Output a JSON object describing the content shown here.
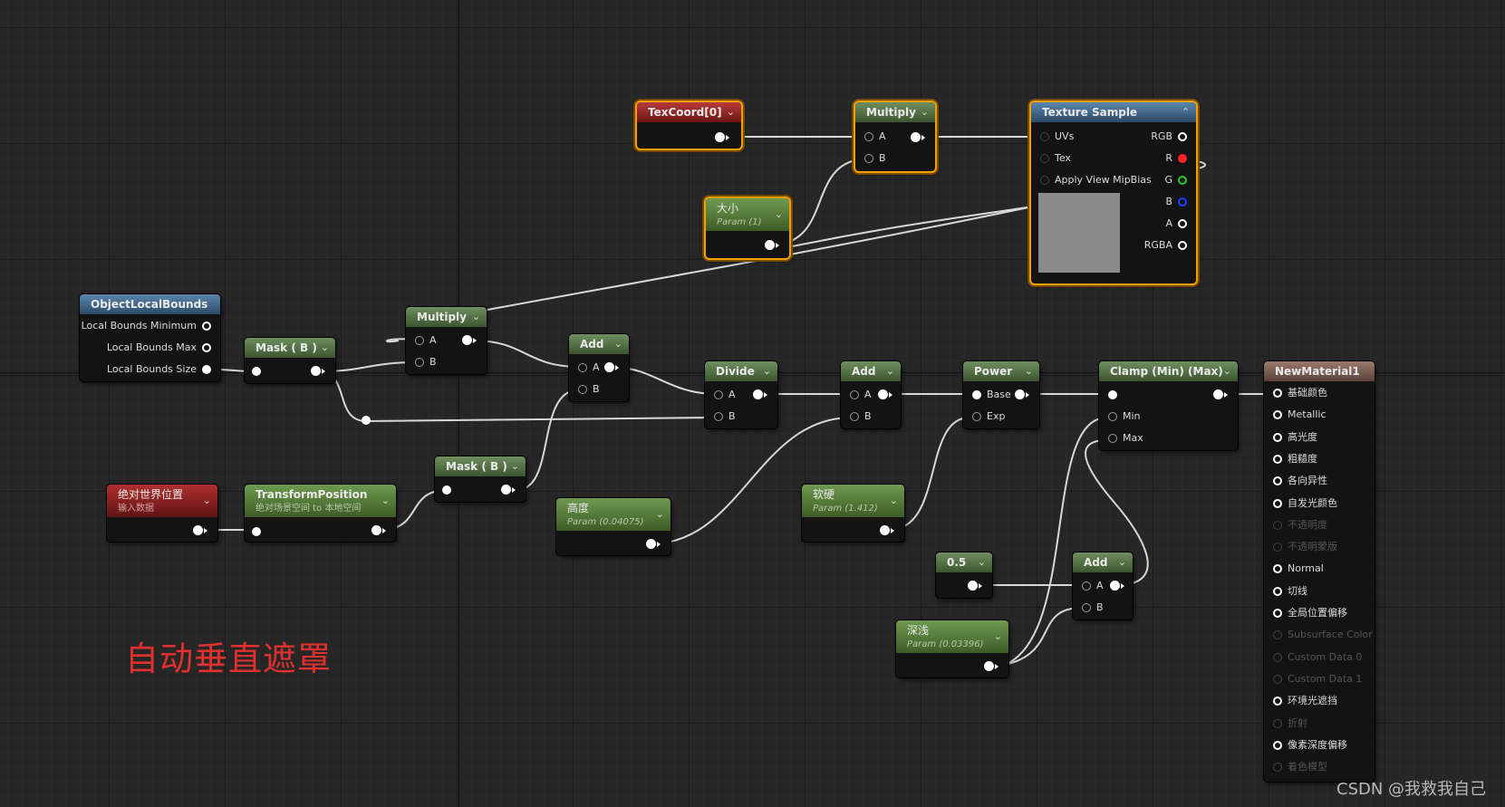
{
  "graph": {
    "note": "自动垂直遮罩",
    "watermark": "CSDN @我救我自己"
  },
  "nodes": {
    "texcoord": {
      "title": "TexCoord[0]"
    },
    "multiply_top": {
      "title": "Multiply",
      "pins": [
        "A",
        "B"
      ]
    },
    "size_param": {
      "title": "大小",
      "subtitle": "Param (1)"
    },
    "texture_sample": {
      "title": "Texture Sample",
      "inputs": [
        "UVs",
        "Tex",
        "Apply View MipBias"
      ],
      "outputs": [
        "RGB",
        "R",
        "G",
        "B",
        "A",
        "RGBA"
      ]
    },
    "object_local_bounds": {
      "title": "ObjectLocalBounds",
      "outputs": [
        "Local Bounds Minimum",
        "Local Bounds Max",
        "Local Bounds Size"
      ]
    },
    "mask_b_1": {
      "title": "Mask ( B )"
    },
    "multiply_mid": {
      "title": "Multiply",
      "pins": [
        "A",
        "B"
      ]
    },
    "add_1": {
      "title": "Add",
      "pins": [
        "A",
        "B"
      ]
    },
    "divide": {
      "title": "Divide",
      "pins": [
        "A",
        "B"
      ]
    },
    "add_2": {
      "title": "Add",
      "pins": [
        "A",
        "B"
      ]
    },
    "power": {
      "title": "Power",
      "pins": [
        "Base",
        "Exp"
      ]
    },
    "clamp": {
      "title": "Clamp (Min) (Max)",
      "pins": [
        "Min",
        "Max"
      ]
    },
    "abs_world_pos": {
      "title": "绝对世界位置",
      "subtitle": "输入数据"
    },
    "transform_position": {
      "title": "TransformPosition",
      "subtitle": "绝对场景空间 to 本地空间"
    },
    "mask_b_2": {
      "title": "Mask ( B )"
    },
    "height_param": {
      "title": "高度",
      "subtitle": "Param (0.04075)"
    },
    "hardness_param": {
      "title": "软硬",
      "subtitle": "Param (1.412)"
    },
    "const_half": {
      "title": "0.5"
    },
    "add_3": {
      "title": "Add",
      "pins": [
        "A",
        "B"
      ]
    },
    "depth_param": {
      "title": "深浅",
      "subtitle": "Param (0.03396)"
    },
    "material": {
      "title": "NewMaterial1",
      "inputs": [
        {
          "label": "基础颜色",
          "enabled": true
        },
        {
          "label": "Metallic",
          "enabled": true
        },
        {
          "label": "高光度",
          "enabled": true
        },
        {
          "label": "粗糙度",
          "enabled": true
        },
        {
          "label": "各向异性",
          "enabled": true
        },
        {
          "label": "自发光颜色",
          "enabled": true
        },
        {
          "label": "不透明度",
          "enabled": false
        },
        {
          "label": "不透明蒙版",
          "enabled": false
        },
        {
          "label": "Normal",
          "enabled": true
        },
        {
          "label": "切线",
          "enabled": true
        },
        {
          "label": "全局位置偏移",
          "enabled": true
        },
        {
          "label": "Subsurface Color",
          "enabled": false
        },
        {
          "label": "Custom Data 0",
          "enabled": false
        },
        {
          "label": "Custom Data 1",
          "enabled": false
        },
        {
          "label": "环境光遮挡",
          "enabled": true
        },
        {
          "label": "折射",
          "enabled": false
        },
        {
          "label": "像素深度偏移",
          "enabled": true
        },
        {
          "label": "着色模型",
          "enabled": false
        }
      ]
    }
  },
  "colors": {
    "selection": "#f0a000",
    "wire": "#d8d8d8",
    "note": "#e03030",
    "pin_r": "#ff2020",
    "pin_g": "#20d020",
    "pin_b": "#2040ff"
  }
}
